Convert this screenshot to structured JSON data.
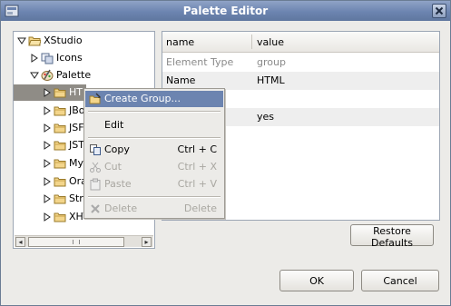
{
  "window": {
    "title": "Palette Editor"
  },
  "tree": {
    "items": [
      {
        "label": "XStudio",
        "expanded": true
      },
      {
        "label": "Icons",
        "expanded": false
      },
      {
        "label": "Palette",
        "expanded": true
      },
      {
        "label": "HTML",
        "expanded": false,
        "selected": true
      },
      {
        "label": "JBoss",
        "expanded": false
      },
      {
        "label": "JSF",
        "expanded": false
      },
      {
        "label": "JSTL",
        "expanded": false
      },
      {
        "label": "MyFaces",
        "expanded": false
      },
      {
        "label": "Oracle",
        "expanded": false
      },
      {
        "label": "Struts",
        "expanded": false
      },
      {
        "label": "XHTML",
        "expanded": false
      }
    ],
    "visible_labels": [
      "HT",
      "JBo",
      "JSF",
      "JST",
      "My",
      "Ora",
      "Str",
      "XHTML"
    ]
  },
  "scrollbar": {
    "left_arrow": "◂",
    "right_arrow": "▸"
  },
  "properties": {
    "columns": [
      "name",
      "value"
    ],
    "rows": [
      {
        "name": "Element Type",
        "value": "group",
        "readonly": true
      },
      {
        "name": "Name",
        "value": "HTML",
        "readonly": false
      },
      {
        "name": "",
        "value": "",
        "readonly": false
      },
      {
        "name": "",
        "value": "yes",
        "readonly": false
      }
    ]
  },
  "buttons": {
    "restore": "Restore Defaults",
    "ok": "OK",
    "cancel": "Cancel"
  },
  "context_menu": {
    "items": [
      {
        "label": "Create Group...",
        "shortcut": "",
        "enabled": true,
        "highlighted": true
      },
      {
        "label": "Edit",
        "shortcut": "",
        "enabled": true
      },
      {
        "label": "Copy",
        "shortcut": "Ctrl + C",
        "enabled": true
      },
      {
        "label": "Cut",
        "shortcut": "Ctrl + X",
        "enabled": false
      },
      {
        "label": "Paste",
        "shortcut": "Ctrl + V",
        "enabled": false
      },
      {
        "label": "Delete",
        "shortcut": "Delete",
        "enabled": false
      }
    ]
  },
  "colors": {
    "titlebar": "#6c84b0",
    "selection": "#8f8c86",
    "menu_highlight": "#6c84b0",
    "background": "#ecebe8"
  }
}
